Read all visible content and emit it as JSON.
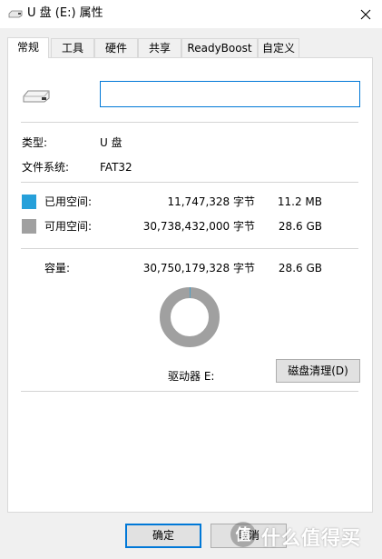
{
  "window": {
    "title": "U 盘 (E:) 属性"
  },
  "tabs": [
    {
      "label": "常规",
      "active": true
    },
    {
      "label": "工具",
      "active": false
    },
    {
      "label": "硬件",
      "active": false
    },
    {
      "label": "共享",
      "active": false
    },
    {
      "label": "ReadyBoost",
      "active": false
    },
    {
      "label": "自定义",
      "active": false
    }
  ],
  "general": {
    "name_value": "",
    "type_label": "类型:",
    "type_value": "U 盘",
    "fs_label": "文件系统:",
    "fs_value": "FAT32",
    "used": {
      "label": "已用空间:",
      "bytes": "11,747,328 字节",
      "size": "11.2 MB",
      "color": "#26a0da"
    },
    "free": {
      "label": "可用空间:",
      "bytes": "30,738,432,000 字节",
      "size": "28.6 GB",
      "color": "#a0a0a0"
    },
    "capacity": {
      "label": "容量:",
      "bytes": "30,750,179,328 字节",
      "size": "28.6 GB"
    },
    "drive_label": "驱动器 E:",
    "cleanup_button": "磁盘清理(D)",
    "usage_fraction": 0.000382
  },
  "footer": {
    "ok_label": "确定",
    "cancel_label": "取消"
  },
  "watermark": {
    "text": "什么值得买"
  },
  "icons": {
    "drive": "usb-drive-icon",
    "close": "close-icon",
    "watermark": "watermark-logo-icon"
  }
}
